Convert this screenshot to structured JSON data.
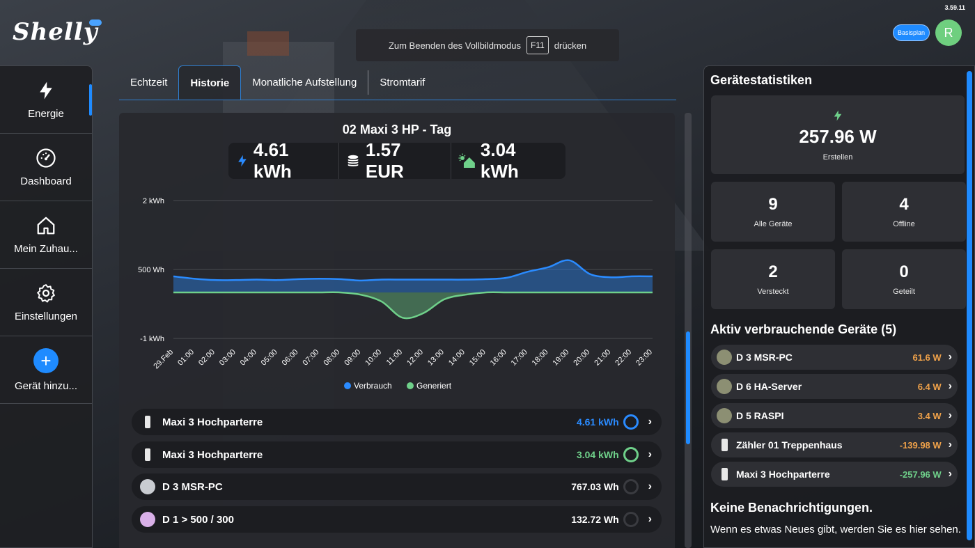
{
  "clock": "3.59.11",
  "logo_text": "Shelly",
  "fullscreen": {
    "prefix": "Zum Beenden des Vollbildmodus",
    "key": "F11",
    "suffix": "drücken"
  },
  "plan_label": "Basisplan",
  "avatar_initial": "R",
  "sidebar": {
    "items": [
      {
        "label": "Energie",
        "icon": "bolt-icon"
      },
      {
        "label": "Dashboard",
        "icon": "gauge-icon"
      },
      {
        "label": "Mein Zuhau...",
        "icon": "home-icon"
      },
      {
        "label": "Einstellungen",
        "icon": "gear-icon"
      },
      {
        "label": "Gerät hinzu...",
        "icon": "plus-icon"
      }
    ]
  },
  "tabs": [
    {
      "label": "Echtzeit"
    },
    {
      "label": "Historie"
    },
    {
      "label": "Monatliche Aufstellung"
    },
    {
      "label": "Stromtarif"
    }
  ],
  "main": {
    "title": "02 Maxi 3 HP - Tag",
    "stats": {
      "consumption": "4.61 kWh",
      "cost": "1.57 EUR",
      "generated": "3.04 kWh"
    }
  },
  "chart_data": {
    "type": "area",
    "x": [
      "29.Feb",
      "01:00",
      "02:00",
      "03:00",
      "04:00",
      "05:00",
      "06:00",
      "07:00",
      "08:00",
      "09:00",
      "10:00",
      "11:00",
      "12:00",
      "13:00",
      "14:00",
      "15:00",
      "16:00",
      "17:00",
      "18:00",
      "19:00",
      "20:00",
      "21:00",
      "22:00",
      "23:00"
    ],
    "y_tick_labels": [
      "2 kWh",
      "500 Wh",
      "-1 kWh"
    ],
    "ylim": [
      -1,
      2
    ],
    "series": [
      {
        "name": "Verbrauch",
        "color": "#2a8bff",
        "values": [
          0.35,
          0.3,
          0.27,
          0.27,
          0.28,
          0.27,
          0.29,
          0.3,
          0.29,
          0.26,
          0.28,
          0.28,
          0.28,
          0.28,
          0.28,
          0.29,
          0.32,
          0.45,
          0.55,
          0.7,
          0.4,
          0.33,
          0.35,
          0.35
        ]
      },
      {
        "name": "Generiert",
        "color": "#6fd08a",
        "values": [
          0.0,
          0.0,
          0.0,
          0.0,
          0.0,
          0.0,
          0.0,
          0.0,
          0.0,
          -0.05,
          -0.2,
          -0.55,
          -0.45,
          -0.15,
          -0.05,
          0.0,
          0.0,
          0.0,
          0.0,
          0.0,
          0.0,
          0.0,
          0.0,
          0.0
        ]
      }
    ],
    "legend": [
      "Verbrauch",
      "Generiert"
    ],
    "grid": true
  },
  "devices": [
    {
      "name": "Maxi 3 Hochparterre",
      "value": "4.61 kWh",
      "value_color": "#2a8bff",
      "ring_color": "#2a8bff"
    },
    {
      "name": "Maxi 3 Hochparterre",
      "value": "3.04 kWh",
      "value_color": "#6fd08a",
      "ring_color": "#6fd08a"
    },
    {
      "name": "D 3 MSR-PC",
      "value": "767.03 Wh",
      "value_color": "#ffffff",
      "ring_color": "#3a3b40"
    },
    {
      "name": "D 1 > 500 / 300",
      "value": "132.72 Wh",
      "value_color": "#ffffff",
      "ring_color": "#3a3b40"
    }
  ],
  "right": {
    "title": "Gerätestatistiken",
    "power": {
      "value": "257.96 W",
      "label": "Erstellen"
    },
    "cards": [
      {
        "value": "9",
        "label": "Alle Geräte"
      },
      {
        "value": "4",
        "label": "Offline"
      },
      {
        "value": "2",
        "label": "Versteckt"
      },
      {
        "value": "0",
        "label": "Geteilt"
      }
    ],
    "active_title": "Aktiv verbrauchende Geräte (5)",
    "active_devices": [
      {
        "name": "D 3 MSR-PC",
        "value": "61.6 W",
        "color": "#f0a24a"
      },
      {
        "name": "D 6 HA-Server",
        "value": "6.4 W",
        "color": "#f0a24a"
      },
      {
        "name": "D 5 RASPI",
        "value": "3.4 W",
        "color": "#f0a24a"
      },
      {
        "name": "Zähler 01 Treppenhaus",
        "value": "-139.98 W",
        "color": "#f0a24a"
      },
      {
        "name": "Maxi 3 Hochparterre",
        "value": "-257.96 W",
        "color": "#6fd08a"
      }
    ],
    "notif_title": "Keine Benachrichtigungen.",
    "notif_text": "Wenn es etwas Neues gibt, werden Sie es hier sehen."
  }
}
